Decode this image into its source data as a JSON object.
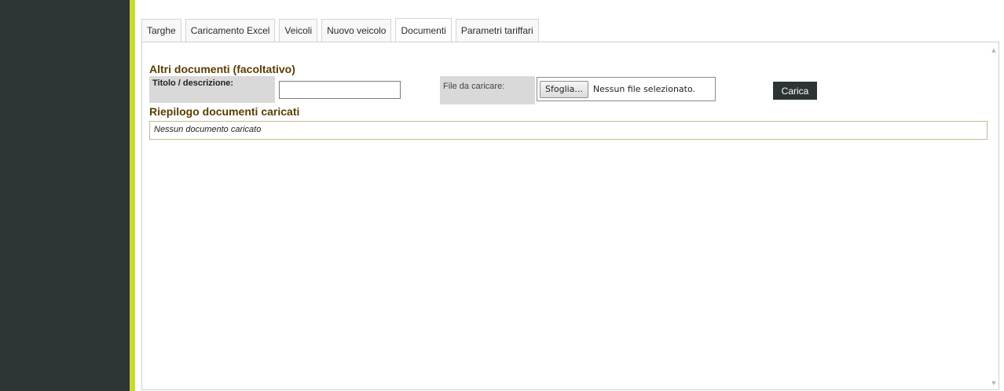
{
  "tabs": [
    {
      "label": "Targhe",
      "active": false
    },
    {
      "label": "Caricamento Excel",
      "active": false
    },
    {
      "label": "Veicoli",
      "active": false
    },
    {
      "label": "Nuovo veicolo",
      "active": false
    },
    {
      "label": "Documenti",
      "active": true
    },
    {
      "label": "Parametri tariffari",
      "active": false
    }
  ],
  "upload_section": {
    "title": "Altri documenti (facoltativo)",
    "title_label": "Titolo / descrizione:",
    "title_value": "",
    "file_label": "File da caricare:",
    "browse_label": "Sfoglia...",
    "file_status": "Nessun file selezionato.",
    "upload_label": "Carica"
  },
  "summary_section": {
    "title": "Riepilogo documenti caricati",
    "empty_message": "Nessun documento caricato"
  },
  "icons": {
    "scroll_up": "scroll-up-arrow",
    "scroll_down": "scroll-down-arrow"
  },
  "colors": {
    "sidebar": "#2d3436",
    "accent": "#c8d932",
    "section_title": "#5a3d00",
    "label_background": "#d9d9d9",
    "upload_button": "#2d3436"
  }
}
